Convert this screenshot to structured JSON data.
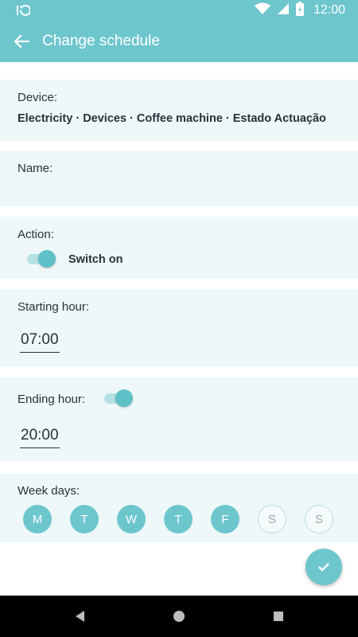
{
  "status_bar": {
    "time": "12:00",
    "icons": [
      "sync-icon",
      "wifi-icon",
      "signal-icon",
      "battery-icon"
    ]
  },
  "app_bar": {
    "title": "Change schedule",
    "back_icon": "arrow-left-icon"
  },
  "device": {
    "label": "Device:",
    "value": "Electricity · Devices · Coffee machine · Estado Actuação"
  },
  "name": {
    "label": "Name:",
    "value": ""
  },
  "action": {
    "label": "Action:",
    "toggle_on": true,
    "value": "Switch on"
  },
  "starting_hour": {
    "label": "Starting hour:",
    "value": "07:00"
  },
  "ending_hour": {
    "label": "Ending hour:",
    "toggle_on": true,
    "value": "20:00"
  },
  "week_days": {
    "label": "Week days:",
    "days": [
      {
        "letter": "M",
        "selected": true
      },
      {
        "letter": "T",
        "selected": true
      },
      {
        "letter": "W",
        "selected": true
      },
      {
        "letter": "T",
        "selected": true
      },
      {
        "letter": "F",
        "selected": true
      },
      {
        "letter": "S",
        "selected": false
      },
      {
        "letter": "S",
        "selected": false
      }
    ]
  },
  "fab": {
    "icon": "check-icon"
  },
  "nav_bar": {
    "icons": [
      "back-triangle-icon",
      "home-circle-icon",
      "recents-square-icon"
    ]
  },
  "colors": {
    "primary": "#6ec6cd",
    "card_background": "#eef8f9",
    "text": "#263238"
  }
}
